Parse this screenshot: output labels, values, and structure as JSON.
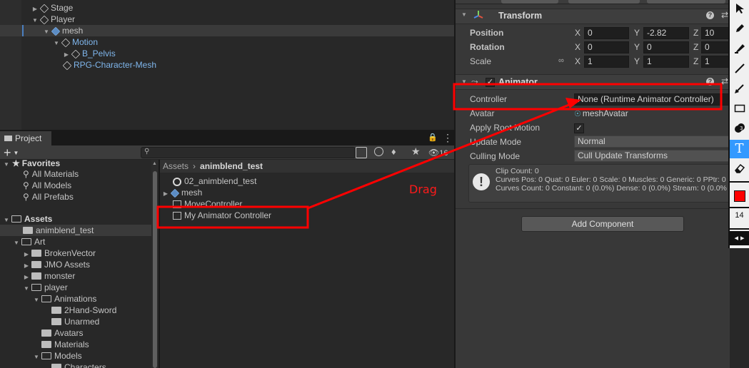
{
  "hierarchy": {
    "items": [
      {
        "label": "Stage"
      },
      {
        "label": "Player"
      },
      {
        "label": "mesh"
      },
      {
        "label": "Motion"
      },
      {
        "label": "B_Pelvis"
      },
      {
        "label": "RPG-Character-Mesh"
      }
    ]
  },
  "project": {
    "tab_label": "Project",
    "add_label": "+",
    "search_placeholder": "",
    "hidden_count": "16",
    "favorites": {
      "title": "Favorites",
      "items": [
        "All Materials",
        "All Models",
        "All Prefabs"
      ]
    },
    "assets_tree": {
      "title": "Assets",
      "items": [
        "animblend_test",
        "Art",
        "BrokenVector",
        "JMO Assets",
        "monster",
        "player",
        "Animations",
        "2Hand-Sword",
        "Unarmed",
        "Avatars",
        "Materials",
        "Models",
        "Characters"
      ]
    },
    "breadcrumb": {
      "root": "Assets",
      "current": "animblend_test"
    },
    "files": [
      "02_animblend_test",
      "mesh",
      "MoveController",
      "My Animator Controller"
    ]
  },
  "annotation": {
    "drag_label": "Drag",
    "color": "#ff0000"
  },
  "inspector": {
    "transform": {
      "title": "Transform",
      "position": {
        "label": "Position",
        "x": "0",
        "y": "-2.82",
        "z": "10"
      },
      "rotation": {
        "label": "Rotation",
        "x": "0",
        "y": "0",
        "z": "0"
      },
      "scale": {
        "label": "Scale",
        "x": "1",
        "y": "1",
        "z": "1"
      },
      "axis": {
        "x": "X",
        "y": "Y",
        "z": "Z"
      }
    },
    "animator": {
      "title": "Animator",
      "controller": {
        "label": "Controller",
        "value": "None (Runtime Animator Controller)"
      },
      "avatar": {
        "label": "Avatar",
        "value": "meshAvatar"
      },
      "apply_root_motion": {
        "label": "Apply Root Motion",
        "checked": true
      },
      "update_mode": {
        "label": "Update Mode",
        "value": "Normal"
      },
      "culling_mode": {
        "label": "Culling Mode",
        "value": "Cull Update Transforms"
      },
      "info": [
        "Clip Count: 0",
        "Curves Pos: 0 Quat: 0 Euler: 0 Scale: 0 Muscles: 0 Generic: 0 PPtr: 0",
        "Curves Count: 0 Constant: 0 (0.0%) Dense: 0 (0.0%) Stream: 0 (0.0%"
      ]
    },
    "add_component_label": "Add Component"
  },
  "toolbar": {
    "font_size": "14",
    "text_tool": "T",
    "accent": "#3399ff",
    "color_swatch": "#ff0000"
  }
}
